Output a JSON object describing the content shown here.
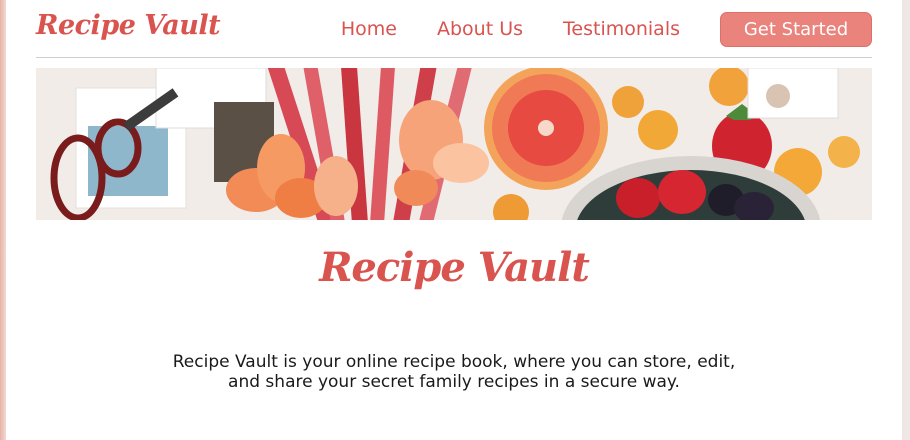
{
  "header": {
    "brand": "Recipe Vault",
    "nav": [
      {
        "label": "Home"
      },
      {
        "label": "About Us"
      },
      {
        "label": "Testimonials"
      }
    ],
    "cta_label": "Get Started"
  },
  "hero": {
    "image_icon": "fruit-flatlay-image"
  },
  "main": {
    "title": "Recipe Vault",
    "description": "Recipe Vault is your online recipe book, where you can store, edit, and share your secret family recipes in a secure way."
  },
  "colors": {
    "brand": "#d9534f",
    "cta_background": "#e9837b",
    "divider": "#cfcfcf"
  }
}
